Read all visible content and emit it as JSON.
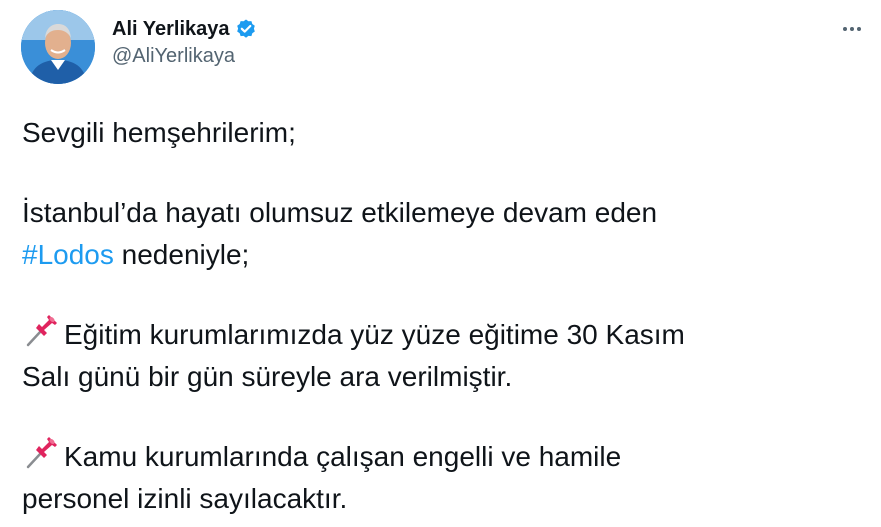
{
  "author": {
    "display_name": "Ali Yerlikaya",
    "handle": "@AliYerlikaya",
    "verified_icon": "verified-badge-icon",
    "avatar_icon": "avatar"
  },
  "menu": {
    "more_icon": "more-options-icon"
  },
  "tweet": {
    "greeting": "Sevgili hemşehrilerim;",
    "line2_prefix": "İstanbul’da hayatı olumsuz etkilemeye devam eden",
    "hashtag": "#Lodos",
    "line2_suffix": " nedeniyle;",
    "item1_line1": "Eğitim kurumlarımızda yüz yüze eğitime 30 Kasım",
    "item1_line2": "Salı günü bir gün süreyle ara verilmiştir.",
    "item2_line1": "Kamu kurumlarında çalışan engelli ve hamile",
    "item2_line2": "personel izinli sayılacaktır.",
    "item_icon": "pushpin-icon"
  },
  "colors": {
    "text": "#0f1419",
    "secondary": "#536471",
    "link": "#1d9bf0",
    "verified": "#1d9bf0",
    "pin": "#e0245e"
  }
}
